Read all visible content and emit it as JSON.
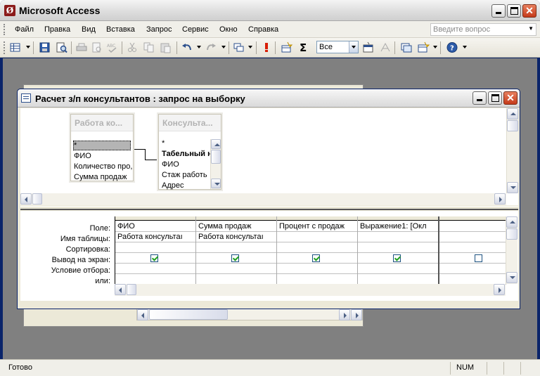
{
  "app": {
    "title": "Microsoft Access",
    "icon_letter": "Ø"
  },
  "menu": {
    "items": [
      "Файл",
      "Правка",
      "Вид",
      "Вставка",
      "Запрос",
      "Сервис",
      "Окно",
      "Справка"
    ],
    "help_placeholder": "Введите вопрос"
  },
  "toolbar": {
    "top_values": "Все"
  },
  "query_window": {
    "title": "Расчет з/п консультантов : запрос на выборку"
  },
  "tables": [
    {
      "title": "Работа ко...",
      "fields": [
        "*",
        "ФИО",
        "Количество про,",
        "Сумма продаж"
      ]
    },
    {
      "title": "Консульта...",
      "fields": [
        "*",
        "Табельный н",
        "ФИО",
        "Стаж работь",
        "Адрес"
      ]
    }
  ],
  "grid": {
    "row_labels": [
      "Поле:",
      "Имя таблицы:",
      "Сортировка:",
      "Вывод на экран:",
      "Условие отбора:",
      "или:"
    ],
    "columns": [
      {
        "field": "ФИО",
        "table": "Работа консультаı",
        "show": true
      },
      {
        "field": "Сумма продаж",
        "table": "Работа консультаı",
        "show": true
      },
      {
        "field": "Процент с продаж",
        "table": "",
        "show": true
      },
      {
        "field": "Выражение1: [Окл",
        "table": "",
        "show": true
      },
      {
        "field": "",
        "table": "",
        "show": false
      }
    ]
  },
  "status": {
    "text": "Готово",
    "num": "NUM"
  },
  "colors": {
    "frame": "#0a246a",
    "workspace": "#808080",
    "check": "#21a121"
  }
}
